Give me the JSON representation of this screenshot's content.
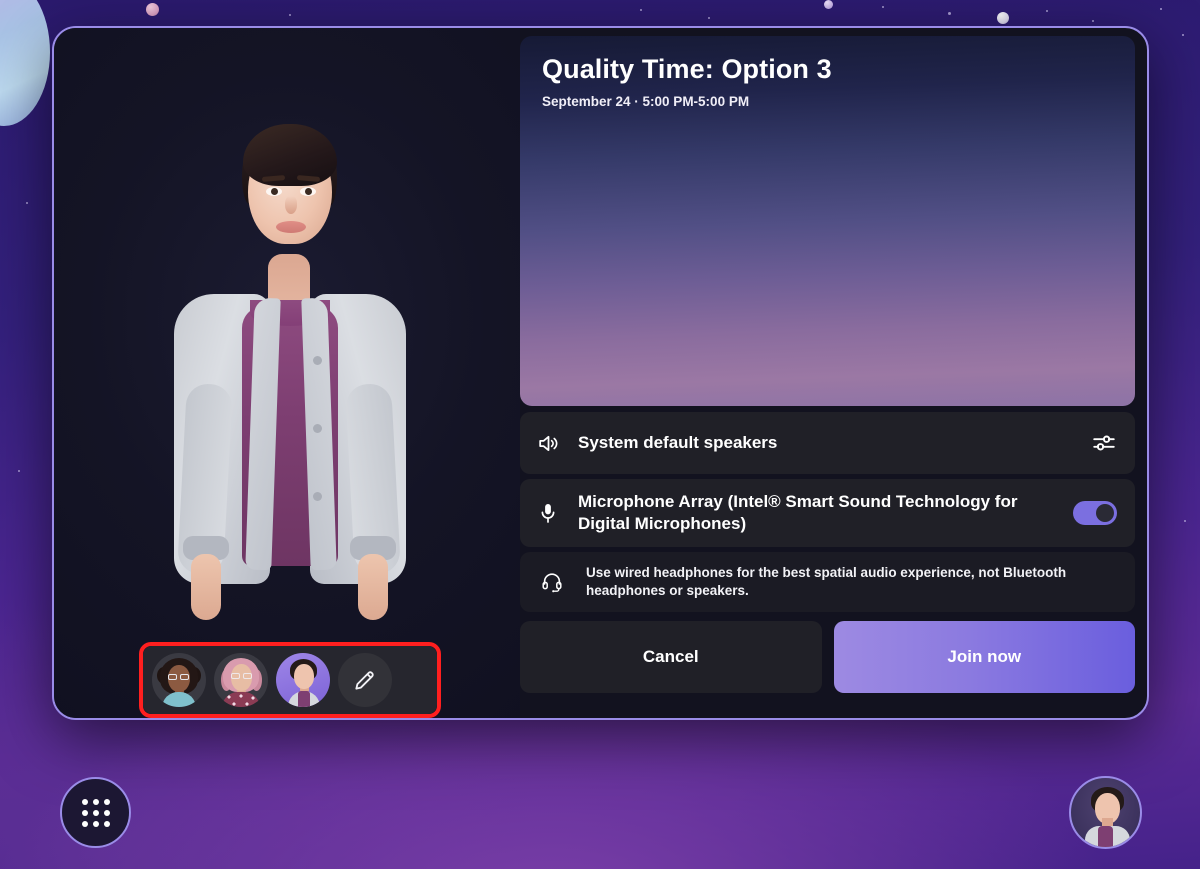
{
  "meeting": {
    "title": "Quality Time: Option 3",
    "subtitle": "September 24 · 5:00 PM-5:00 PM"
  },
  "audio": {
    "speakers": {
      "label": "System default speakers",
      "icon": "speaker-icon",
      "settings_icon": "audio-settings-icon"
    },
    "microphone": {
      "label": "Microphone Array (Intel® Smart Sound Technology for Digital Microphones)",
      "icon": "microphone-icon",
      "toggle_state": "on"
    },
    "hint": {
      "text": "Use wired headphones for the best spatial audio experience, not Bluetooth headphones or speakers.",
      "icon": "headset-icon"
    }
  },
  "actions": {
    "cancel_label": "Cancel",
    "join_label": "Join now"
  },
  "avatar_picker": {
    "choices": [
      {
        "name": "avatar-option-1",
        "selected": false
      },
      {
        "name": "avatar-option-2",
        "selected": false
      },
      {
        "name": "avatar-option-3",
        "selected": true
      }
    ],
    "edit_icon": "pencil-icon",
    "highlight_color": "#ff1f1f"
  },
  "taskbar": {
    "apps_icon": "app-grid-icon",
    "profile_icon": "user-avatar-icon"
  },
  "colors": {
    "dialog_border": "#9a8ce8",
    "dialog_background": "#12121f",
    "join_gradient_start": "#9d8ae2",
    "join_gradient_end": "#6a5ede",
    "toggle_on": "#7b6fe0",
    "row_background": "#202027",
    "highlight": "#ff1f1f"
  }
}
